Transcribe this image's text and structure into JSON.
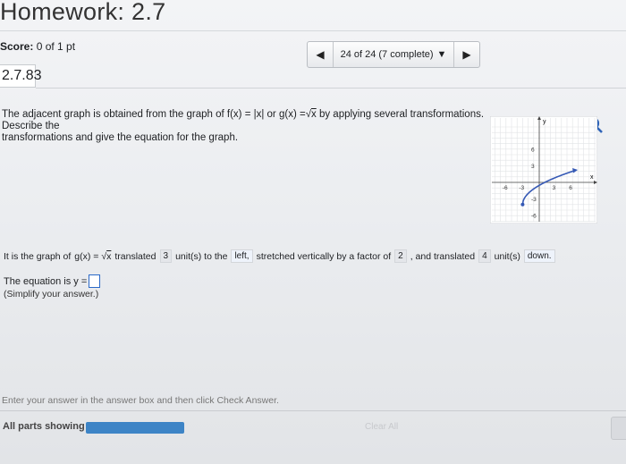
{
  "header": {
    "title": "Homework: 2.7",
    "score_label": "Score:",
    "score_value": "0 of 1 pt"
  },
  "nav": {
    "prev_icon": "left-triangle-icon",
    "next_icon": "right-triangle-icon",
    "progress_label": "24 of 24 (7 complete)"
  },
  "question": {
    "number": "2.7.83",
    "prompt_line1_a": "The adjacent graph is obtained from the graph of",
    "f_expr": "f(x) = |x|",
    "or": "or",
    "g_expr_pre": "g(x) =",
    "g_expr_rad": "x",
    "prompt_line1_b": "by applying several transformations. Describe the",
    "prompt_line2": "transformations and give the equation for the graph."
  },
  "graph": {
    "x_label": "x",
    "y_label": "y",
    "x_ticks": [
      "-6",
      "-3",
      "3",
      "6"
    ],
    "y_ticks": [
      "6",
      "3",
      "-3",
      "-6"
    ],
    "curve_color": "#3559b5"
  },
  "answer": {
    "pre": "It is the graph of",
    "g_pre": "g(x) =",
    "g_rad": "x",
    "translated": "translated",
    "h_shift": "3",
    "units_to_the": "unit(s) to the",
    "direction": "left,",
    "stretched": "stretched vertically by a factor of",
    "factor": "2",
    "and_translated": ", and translated",
    "v_shift": "4",
    "units": "unit(s)",
    "v_direction": "down."
  },
  "equation": {
    "label": "The equation is y =",
    "simplify": "(Simplify your answer.)"
  },
  "footer": {
    "instructions": "Enter your answer in the answer box and then click Check Answer.",
    "parts_label": "All parts showing",
    "progress_fraction": 1.0,
    "clear_all": "Clear All"
  },
  "colors": {
    "accent": "#3d84c6",
    "curve": "#3559b5"
  }
}
